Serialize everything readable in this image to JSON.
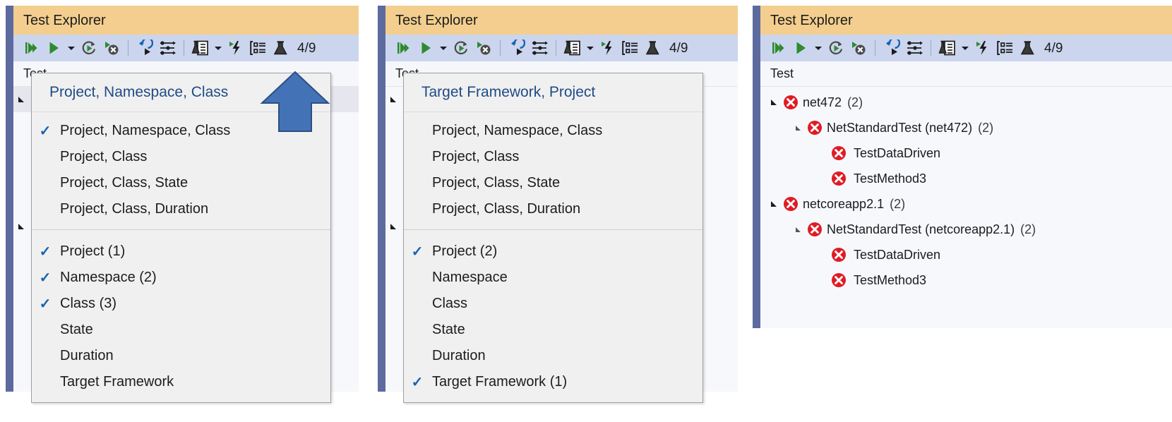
{
  "window": {
    "title": "Test Explorer",
    "toolbar": {
      "buttons": [
        {
          "name": "run-all-tests-icon",
          "label": "Run All Tests"
        },
        {
          "name": "run-icon",
          "label": "Run"
        },
        {
          "name": "run-dropdown-caret-icon",
          "label": "Run options"
        },
        {
          "name": "repeat-last-run-icon",
          "label": "Repeat Last Run"
        },
        {
          "name": "stop-test-run-icon",
          "label": "Cancel"
        },
        {
          "name": "run-failed-tests-icon",
          "label": "Run Failed Tests"
        },
        {
          "name": "playlist-icon",
          "label": "Playlist"
        },
        {
          "name": "analyze-coverage-icon",
          "label": "Analyze Code Coverage"
        },
        {
          "name": "coverage-dropdown-caret-icon",
          "label": "Coverage options"
        },
        {
          "name": "profile-test-icon",
          "label": "Profile Test"
        },
        {
          "name": "group-by-icon",
          "label": "Group By"
        },
        {
          "name": "test-settings-icon",
          "label": "Test Settings"
        }
      ],
      "count": "4/9"
    },
    "column_header": "Test"
  },
  "menu_groups": {
    "layouts": [
      "Project, Namespace, Class",
      "Project, Class",
      "Project, Class, State",
      "Project, Class, Duration"
    ],
    "fields": [
      "Project",
      "Namespace",
      "Class",
      "State",
      "Duration",
      "Target Framework"
    ]
  },
  "panels": [
    {
      "id": "panel-grouping-project-namespace-class",
      "menu": {
        "header": "Project, Namespace, Class",
        "layout_items": [
          {
            "label": "Project, Namespace, Class",
            "checked": true
          },
          {
            "label": "Project, Class",
            "checked": false
          },
          {
            "label": "Project, Class, State",
            "checked": false
          },
          {
            "label": "Project, Class, Duration",
            "checked": false
          }
        ],
        "field_items": [
          {
            "label": "Project (1)",
            "checked": true
          },
          {
            "label": "Namespace (2)",
            "checked": true
          },
          {
            "label": "Class (3)",
            "checked": true
          },
          {
            "label": "State",
            "checked": false
          },
          {
            "label": "Duration",
            "checked": false
          },
          {
            "label": "Target Framework",
            "checked": false
          }
        ]
      },
      "annotation": {
        "name": "up-arrow-annotation",
        "color": "#4472b6"
      }
    },
    {
      "id": "panel-grouping-target-framework-project",
      "menu": {
        "header": "Target Framework, Project",
        "layout_items": [
          {
            "label": "Project, Namespace, Class",
            "checked": false
          },
          {
            "label": "Project, Class",
            "checked": false
          },
          {
            "label": "Project, Class, State",
            "checked": false
          },
          {
            "label": "Project, Class, Duration",
            "checked": false
          }
        ],
        "field_items": [
          {
            "label": "Project (2)",
            "checked": true
          },
          {
            "label": "Namespace",
            "checked": false
          },
          {
            "label": "Class",
            "checked": false
          },
          {
            "label": "State",
            "checked": false
          },
          {
            "label": "Duration",
            "checked": false
          },
          {
            "label": "Target Framework (1)",
            "checked": true
          }
        ]
      }
    },
    {
      "id": "panel-test-results-tree",
      "tree": [
        {
          "label": "net472",
          "count": "(2)",
          "depth": 0,
          "status": "failed",
          "expandable": true
        },
        {
          "label": "NetStandardTest (net472)",
          "count": "(2)",
          "depth": 1,
          "status": "failed",
          "expandable": true
        },
        {
          "label": "TestDataDriven",
          "count": "",
          "depth": 2,
          "status": "failed",
          "expandable": false
        },
        {
          "label": "TestMethod3",
          "count": "",
          "depth": 2,
          "status": "failed",
          "expandable": false
        },
        {
          "label": "netcoreapp2.1",
          "count": "(2)",
          "depth": 0,
          "status": "failed",
          "expandable": true
        },
        {
          "label": "NetStandardTest (netcoreapp2.1)",
          "count": "(2)",
          "depth": 1,
          "status": "failed",
          "expandable": true
        },
        {
          "label": "TestDataDriven",
          "count": "",
          "depth": 2,
          "status": "failed",
          "expandable": false
        },
        {
          "label": "TestMethod3",
          "count": "",
          "depth": 2,
          "status": "failed",
          "expandable": false
        }
      ]
    }
  ],
  "colors": {
    "title_bar": "#f3ce8e",
    "toolbar": "#ccd5ee",
    "window_edge": "#5c6a9e",
    "menu_bg": "#f0f0f0",
    "check_blue": "#1764b0",
    "header_link": "#1f4b85",
    "fail_red": "#e01b24",
    "run_green": "#2e8b2e",
    "arrow_blue": "#4472b6"
  }
}
